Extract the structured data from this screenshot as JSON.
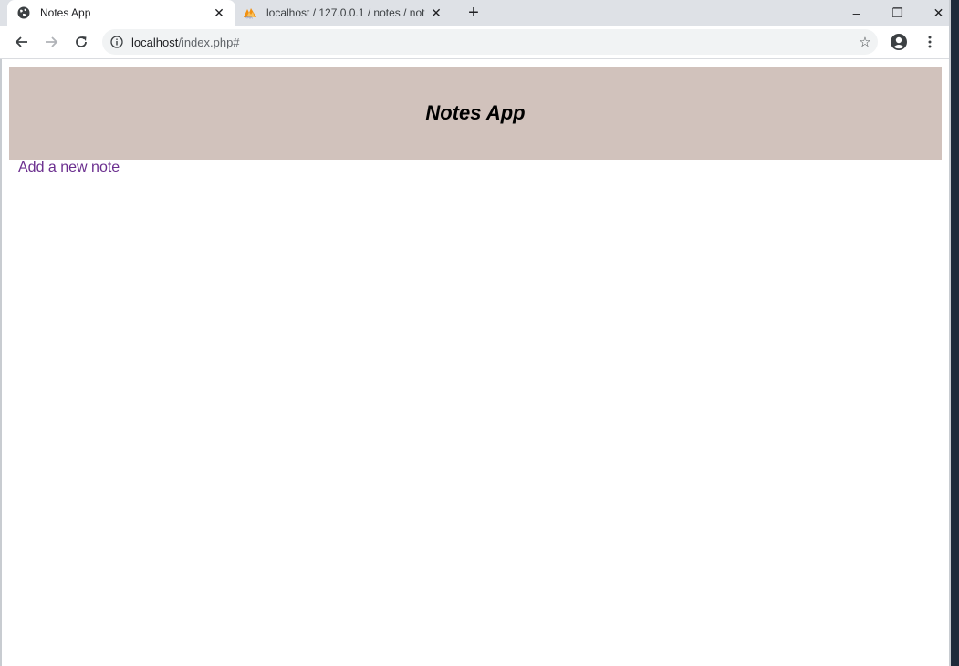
{
  "browser": {
    "tabs": [
      {
        "title": "Notes App",
        "favicon": "globe-icon",
        "active": true
      },
      {
        "title": "localhost / 127.0.0.1 / notes / not",
        "favicon": "phpmyadmin-icon",
        "active": false
      }
    ],
    "new_tab_label": "+",
    "window_controls": {
      "minimize": "–",
      "restore": "❐",
      "close": "✕"
    },
    "url": {
      "host": "localhost",
      "path": "/index.php#"
    }
  },
  "page": {
    "header_title": "Notes App",
    "header_bg": "#d1c2bc",
    "add_note_link": "Add a new note",
    "link_color": "#6b2f8f"
  }
}
